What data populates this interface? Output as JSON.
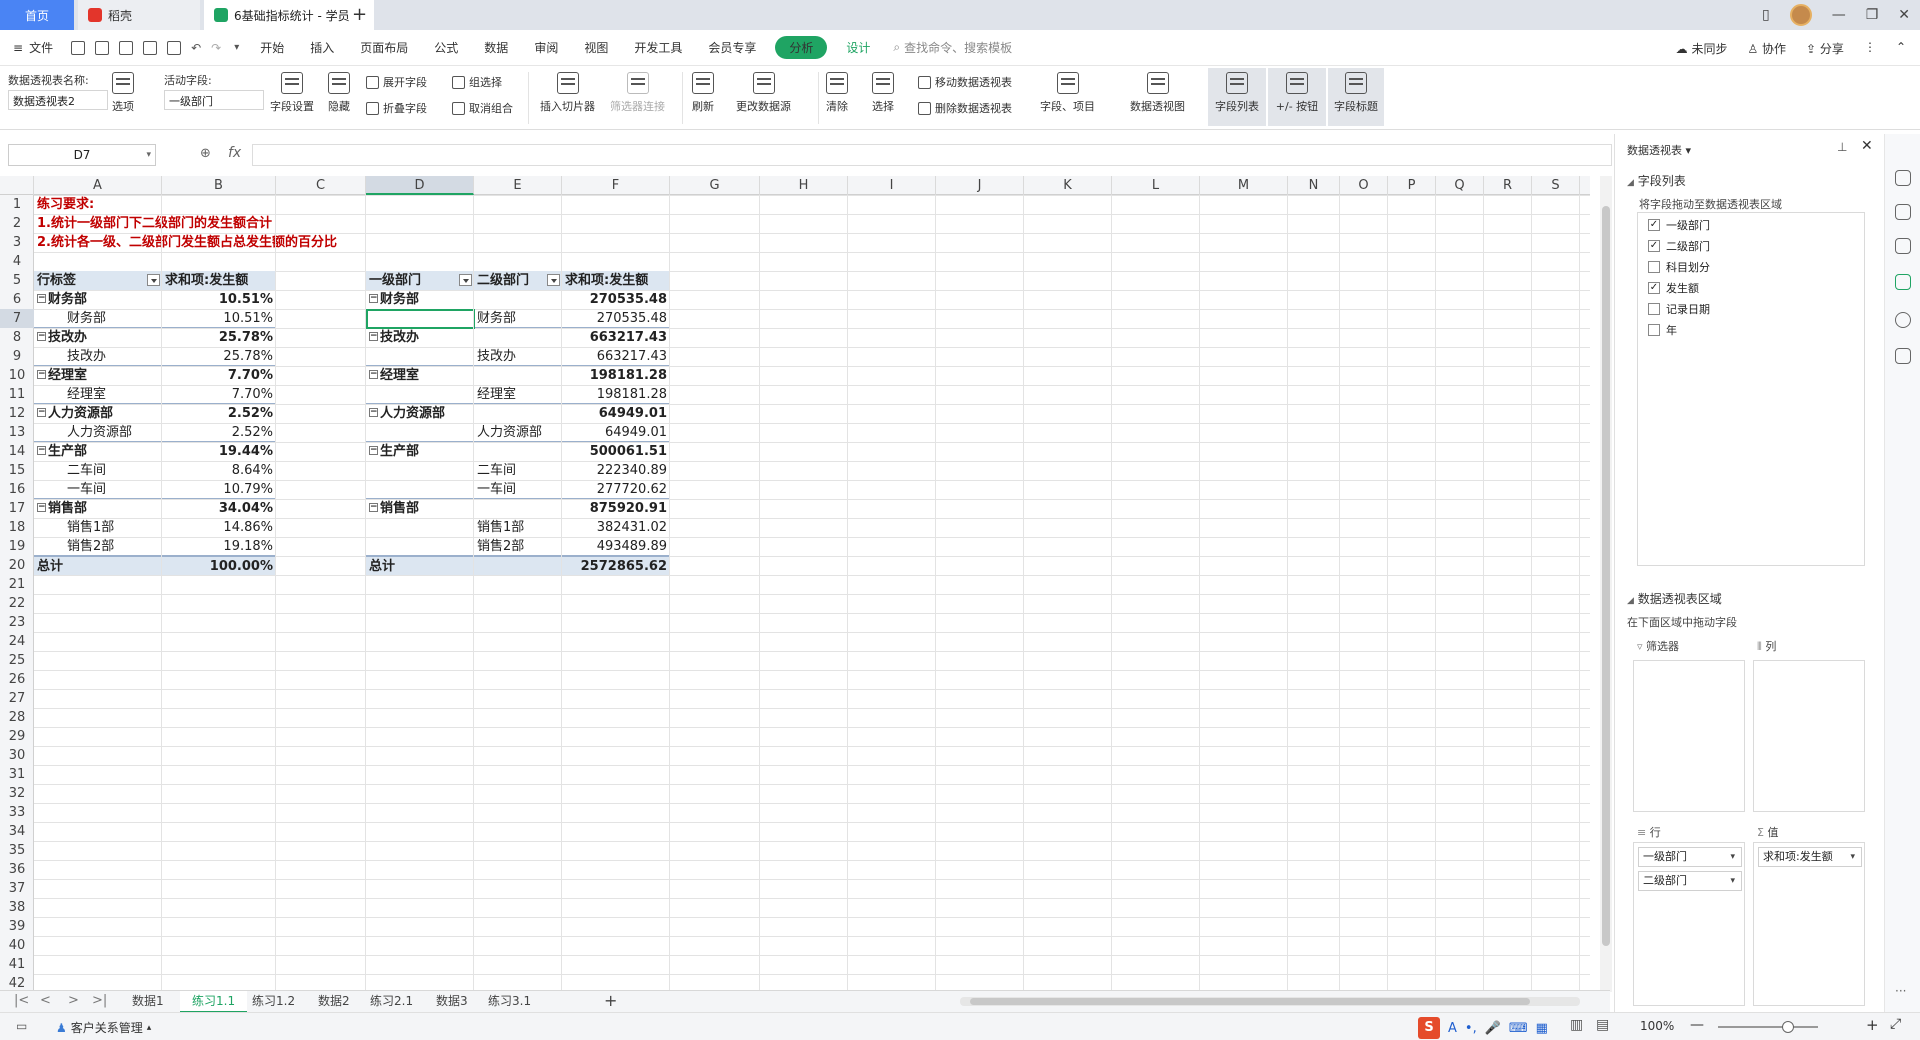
{
  "titlebar": {
    "tabs": [
      {
        "label": "首页"
      },
      {
        "label": "稻壳"
      },
      {
        "label": "6基础指标统计 - 学员"
      }
    ],
    "new_tab": "+"
  },
  "menubar": {
    "file": "文件",
    "items": [
      "开始",
      "插入",
      "页面布局",
      "公式",
      "数据",
      "审阅",
      "视图",
      "开发工具",
      "会员专享"
    ],
    "analysis": "分析",
    "design": "设计",
    "search": "查找命令、搜索模板",
    "sync": "未同步",
    "collab": "协作",
    "share": "分享"
  },
  "ribbon": {
    "pivot_name_label": "数据透视表名称:",
    "pivot_name_value": "数据透视表2",
    "options": "选项",
    "active_field_label": "活动字段:",
    "active_field_value": "一级部门",
    "field_settings": "字段设置",
    "hide": "隐藏",
    "expand_field": "展开字段",
    "collapse_field": "折叠字段",
    "group_select": "组选择",
    "ungroup": "取消组合",
    "insert_slicer": "插入切片器",
    "filter_connect": "筛选器连接",
    "refresh": "刷新",
    "change_source": "更改数据源",
    "clear": "清除",
    "select": "选择",
    "move_pivot": "移动数据透视表",
    "delete_pivot": "删除数据透视表",
    "fields_items": "字段、项目",
    "pivot_chart": "数据透视图",
    "field_list": "字段列表",
    "plus_minus": "+/- 按钮",
    "field_headers": "字段标题"
  },
  "formula_bar": {
    "name_box": "D7",
    "fx": "fx",
    "value": ""
  },
  "columns": [
    "A",
    "B",
    "C",
    "D",
    "E",
    "F",
    "G",
    "H",
    "I",
    "J",
    "K",
    "L",
    "M",
    "N",
    "O",
    "P",
    "Q",
    "R",
    "S"
  ],
  "rows": [
    "1",
    "2",
    "3",
    "4",
    "5",
    "6",
    "7",
    "8",
    "9",
    "10",
    "11",
    "12",
    "13",
    "14",
    "15",
    "16",
    "17",
    "18",
    "19",
    "20",
    "21",
    "22",
    "23",
    "24",
    "25",
    "26",
    "27",
    "28",
    "29",
    "30",
    "31",
    "32",
    "33",
    "34",
    "35",
    "36",
    "37",
    "38",
    "39",
    "40",
    "41",
    "42"
  ],
  "sheet": {
    "title1": "练习要求:",
    "title2": "1.统计一级部门下二级部门的发生额合计",
    "title3": "2.统计各一级、二级部门发生额占总发生额的百分比",
    "pivot1": {
      "h1": "行标签",
      "h2": "求和项:发生额",
      "rows": [
        {
          "label": "财务部",
          "value": "10.51%",
          "level": 1
        },
        {
          "label": "财务部",
          "value": "10.51%",
          "level": 2
        },
        {
          "label": "技改办",
          "value": "25.78%",
          "level": 1
        },
        {
          "label": "技改办",
          "value": "25.78%",
          "level": 2
        },
        {
          "label": "经理室",
          "value": "7.70%",
          "level": 1
        },
        {
          "label": "经理室",
          "value": "7.70%",
          "level": 2
        },
        {
          "label": "人力资源部",
          "value": "2.52%",
          "level": 1
        },
        {
          "label": "人力资源部",
          "value": "2.52%",
          "level": 2
        },
        {
          "label": "生产部",
          "value": "19.44%",
          "level": 1
        },
        {
          "label": "二车间",
          "value": "8.64%",
          "level": 2
        },
        {
          "label": "一车间",
          "value": "10.79%",
          "level": 2
        },
        {
          "label": "销售部",
          "value": "34.04%",
          "level": 1
        },
        {
          "label": "销售1部",
          "value": "14.86%",
          "level": 2
        },
        {
          "label": "销售2部",
          "value": "19.18%",
          "level": 2
        }
      ],
      "total_label": "总计",
      "total_value": "100.00%"
    },
    "pivot2": {
      "h1": "一级部门",
      "h2": "二级部门",
      "h3": "求和项:发生额",
      "rows": [
        {
          "d": "财务部",
          "e": "",
          "f": "270535.48",
          "level": 1
        },
        {
          "d": "",
          "e": "财务部",
          "f": "270535.48",
          "level": 2
        },
        {
          "d": "技改办",
          "e": "",
          "f": "663217.43",
          "level": 1
        },
        {
          "d": "",
          "e": "技改办",
          "f": "663217.43",
          "level": 2
        },
        {
          "d": "经理室",
          "e": "",
          "f": "198181.28",
          "level": 1
        },
        {
          "d": "",
          "e": "经理室",
          "f": "198181.28",
          "level": 2
        },
        {
          "d": "人力资源部",
          "e": "",
          "f": "64949.01",
          "level": 1
        },
        {
          "d": "",
          "e": "人力资源部",
          "f": "64949.01",
          "level": 2
        },
        {
          "d": "生产部",
          "e": "",
          "f": "500061.51",
          "level": 1
        },
        {
          "d": "",
          "e": "二车间",
          "f": "222340.89",
          "level": 2
        },
        {
          "d": "",
          "e": "一车间",
          "f": "277720.62",
          "level": 2
        },
        {
          "d": "销售部",
          "e": "",
          "f": "875920.91",
          "level": 1
        },
        {
          "d": "",
          "e": "销售1部",
          "f": "382431.02",
          "level": 2
        },
        {
          "d": "",
          "e": "销售2部",
          "f": "493489.89",
          "level": 2
        }
      ],
      "total_label": "总计",
      "total_value": "2572865.62"
    }
  },
  "sheet_tabs": [
    "数据1",
    "练习1.1",
    "练习1.2",
    "数据2",
    "练习2.1",
    "数据3",
    "练习3.1"
  ],
  "active_sheet": "练习1.1",
  "statusbar": {
    "crm": "客户关系管理",
    "zoom": "100%"
  },
  "panel": {
    "title": "数据透视表",
    "field_list_title": "字段列表",
    "field_list_hint": "将字段拖动至数据透视表区域",
    "fields": [
      {
        "label": "一级部门",
        "checked": true
      },
      {
        "label": "二级部门",
        "checked": true
      },
      {
        "label": "科目划分",
        "checked": false
      },
      {
        "label": "发生额",
        "checked": true
      },
      {
        "label": "记录日期",
        "checked": false
      },
      {
        "label": "年",
        "checked": false
      }
    ],
    "areas_title": "数据透视表区域",
    "areas_hint": "在下面区域中拖动字段",
    "filter_label": "筛选器",
    "col_label": "列",
    "row_label": "行",
    "value_label": "值",
    "row_items": [
      "一级部门",
      "二级部门"
    ],
    "value_items": [
      "求和项:发生额"
    ]
  }
}
